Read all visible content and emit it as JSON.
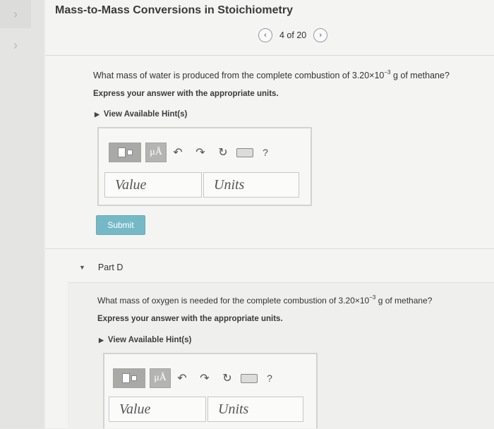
{
  "sidebar": {
    "toggle_top": "›",
    "toggle_second": "›"
  },
  "header": {
    "title": "Mass-to-Mass Conversions in Stoichiometry"
  },
  "pager": {
    "prev_icon": "‹",
    "label": "4 of 20",
    "next_icon": "›"
  },
  "part_c": {
    "question_prefix": "What mass of water is produced from the complete combustion of 3.20×10",
    "question_exp": "−3",
    "question_suffix": " g of methane?",
    "instruction": "Express your answer with the appropriate units.",
    "hint_link": "View Available Hint(s)",
    "value_placeholder": "Value",
    "units_placeholder": "Units",
    "submit_label": "Submit"
  },
  "part_d": {
    "label": "Part D",
    "question_prefix": "What mass of oxygen is needed for the complete combustion of 3.20×10",
    "question_exp": "−3",
    "question_suffix": " g of methane?",
    "instruction": "Express your answer with the appropriate units.",
    "hint_link": "View Available Hint(s)",
    "value_placeholder": "Value",
    "units_placeholder": "Units"
  },
  "toolbar": {
    "mu_label": "μÅ",
    "undo_icon": "↶",
    "redo_icon": "↷",
    "reset_icon": "↻",
    "help_label": "?"
  }
}
